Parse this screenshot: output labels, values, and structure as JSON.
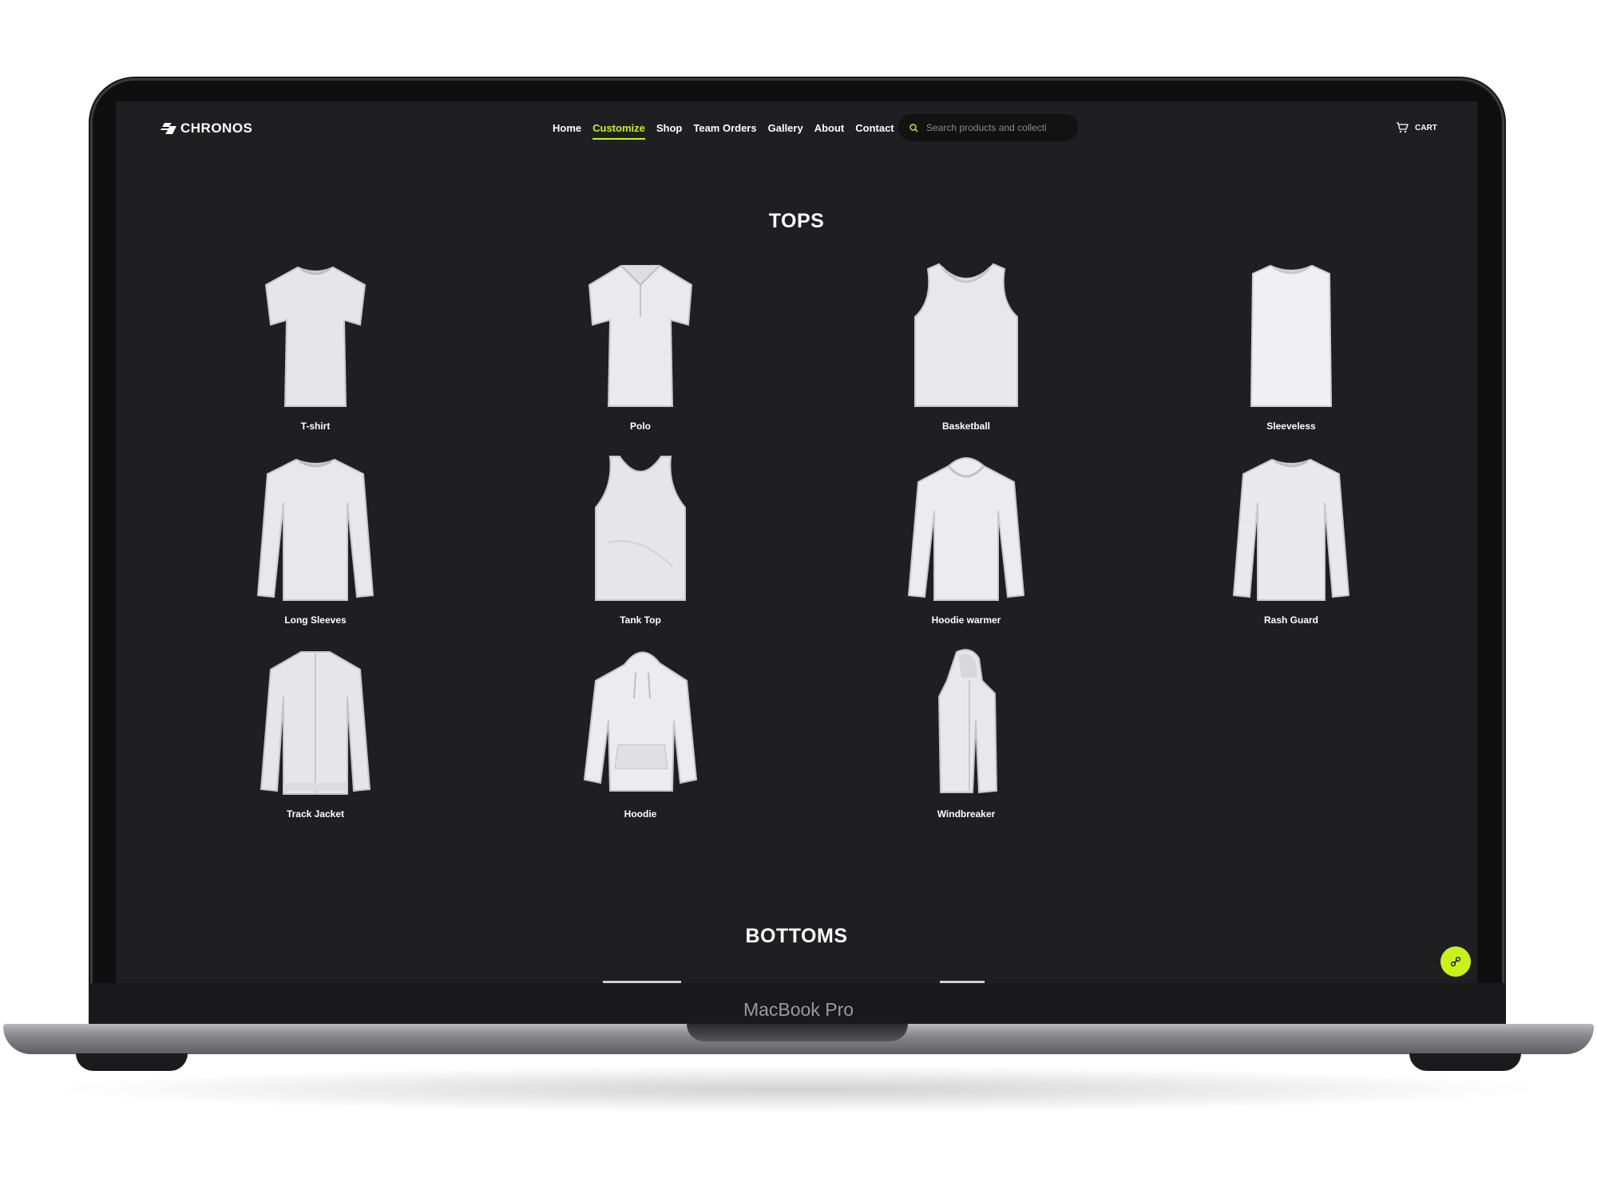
{
  "brand": {
    "name": "CHRONOS",
    "accent": "#c8f11c"
  },
  "nav": {
    "items": [
      {
        "label": "Home",
        "active": false
      },
      {
        "label": "Customize",
        "active": true
      },
      {
        "label": "Shop",
        "active": false
      },
      {
        "label": "Team Orders",
        "active": false
      },
      {
        "label": "Gallery",
        "active": false
      },
      {
        "label": "About",
        "active": false
      },
      {
        "label": "Contact",
        "active": false
      }
    ],
    "search_placeholder": "Search products and collecti",
    "cart_label": "CART"
  },
  "sections": {
    "tops": {
      "title": "TOPS",
      "products": [
        {
          "name": "T-shirt",
          "icon": "tshirt-icon"
        },
        {
          "name": "Polo",
          "icon": "polo-icon"
        },
        {
          "name": "Basketball",
          "icon": "basketball-jersey-icon"
        },
        {
          "name": "Sleeveless",
          "icon": "sleeveless-icon"
        },
        {
          "name": "Long Sleeves",
          "icon": "long-sleeve-icon"
        },
        {
          "name": "Tank Top",
          "icon": "tank-top-icon"
        },
        {
          "name": "Hoodie warmer",
          "icon": "hoodie-warmer-icon"
        },
        {
          "name": "Rash Guard",
          "icon": "rash-guard-icon"
        },
        {
          "name": "Track Jacket",
          "icon": "track-jacket-icon"
        },
        {
          "name": "Hoodie",
          "icon": "hoodie-icon"
        },
        {
          "name": "Windbreaker",
          "icon": "windbreaker-icon"
        }
      ]
    },
    "bottoms": {
      "title": "BOTTOMS"
    }
  },
  "device": {
    "label": "MacBook Pro"
  }
}
